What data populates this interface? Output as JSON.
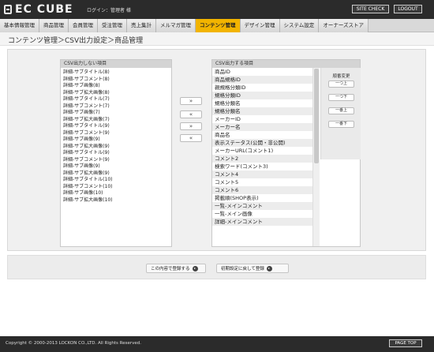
{
  "header": {
    "logo_text": "EC CUBE",
    "login_info": "ログイン：管理者 様",
    "site_check_label": "SITE CHECK",
    "logout_label": "LOGOUT"
  },
  "nav": {
    "items": [
      {
        "label": "基本情報管理",
        "active": false
      },
      {
        "label": "商品管理",
        "active": false
      },
      {
        "label": "会員管理",
        "active": false
      },
      {
        "label": "受注管理",
        "active": false
      },
      {
        "label": "売上集計",
        "active": false
      },
      {
        "label": "メルマガ管理",
        "active": false
      },
      {
        "label": "コンテンツ管理",
        "active": true
      },
      {
        "label": "デザイン管理",
        "active": false
      },
      {
        "label": "システム設定",
        "active": false
      },
      {
        "label": "オーナーズストア",
        "active": false
      }
    ]
  },
  "page_title": "コンテンツ管理＞CSV出力設定＞商品管理",
  "left_list": {
    "heading": "CSV出力しない項目",
    "items": [
      "詳細-サブタイトル(8)",
      "詳細-サブコメント(8)",
      "詳細-サブ画像(8)",
      "詳細-サブ拡大画像(8)",
      "詳細-サブタイトル(7)",
      "詳細-サブコメント(7)",
      "詳細-サブ画像(7)",
      "詳細-サブ拡大画像(7)",
      "詳細-サブタイトル(9)",
      "詳細-サブコメント(9)",
      "詳細-サブ画像(9)",
      "詳細-サブ拡大画像(9)",
      "詳細-サブタイトル(9)",
      "詳細-サブコメント(9)",
      "詳細-サブ画像(9)",
      "詳細-サブ拡大画像(9)",
      "詳細-サブタイトル(10)",
      "詳細-サブコメント(10)",
      "詳細-サブ画像(10)",
      "詳細-サブ拡大画像(10)"
    ]
  },
  "right_list": {
    "heading": "CSV出力する項目",
    "items": [
      "商品ID",
      "商品規格ID",
      "親規格分類ID",
      "規格分類ID",
      "規格分類名",
      "規格分類名",
      "メーカーID",
      "メーカー名",
      "商品名",
      "表示ステータス(公開・非公開)",
      "メーカーURL(コメント1)",
      "コメント2",
      "検索ワード(コメント3)",
      "コメント4",
      "コメント5",
      "コメント6",
      "掲載順(SHOP表示)",
      "一覧-メインコメント",
      "一覧-メイン画像",
      "詳細-メインコメント"
    ]
  },
  "move_buttons": [
    "»",
    "«",
    "»",
    "«"
  ],
  "order_panel": {
    "title": "順番変更",
    "buttons": [
      "一つ上",
      "一つ下",
      "一番上",
      "一番下"
    ]
  },
  "actions": {
    "register_label": "この内容で登録する",
    "reset_label": "初期設定に戻して登録"
  },
  "footer": {
    "copyright": "Copyright © 2000-2013 LOCKON CO.,LTD. All Rights Reserved.",
    "page_top_label": "PAGE TOP"
  }
}
